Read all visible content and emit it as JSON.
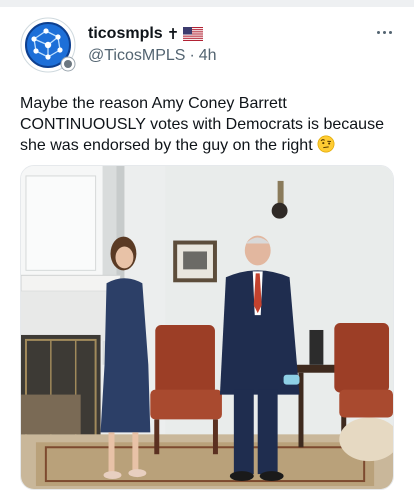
{
  "tweet": {
    "author": {
      "display_name": "ticosmpls",
      "name_emoji": "✝",
      "flag": "🇺🇸",
      "handle": "@TicosMPLS",
      "separator": "·",
      "time": "4h"
    },
    "more_icon": "ellipsis-icon",
    "text": "Maybe the reason Amy Coney Barrett CONTINUOUSLY votes with Democrats is because she was endorsed by the guy on the right",
    "text_emoji": "🤨",
    "media": {
      "type": "photo",
      "description_icon": "photo-image"
    }
  },
  "colors": {
    "text_primary": "#0f1419",
    "text_secondary": "#536471",
    "border": "#e6e9ec"
  }
}
